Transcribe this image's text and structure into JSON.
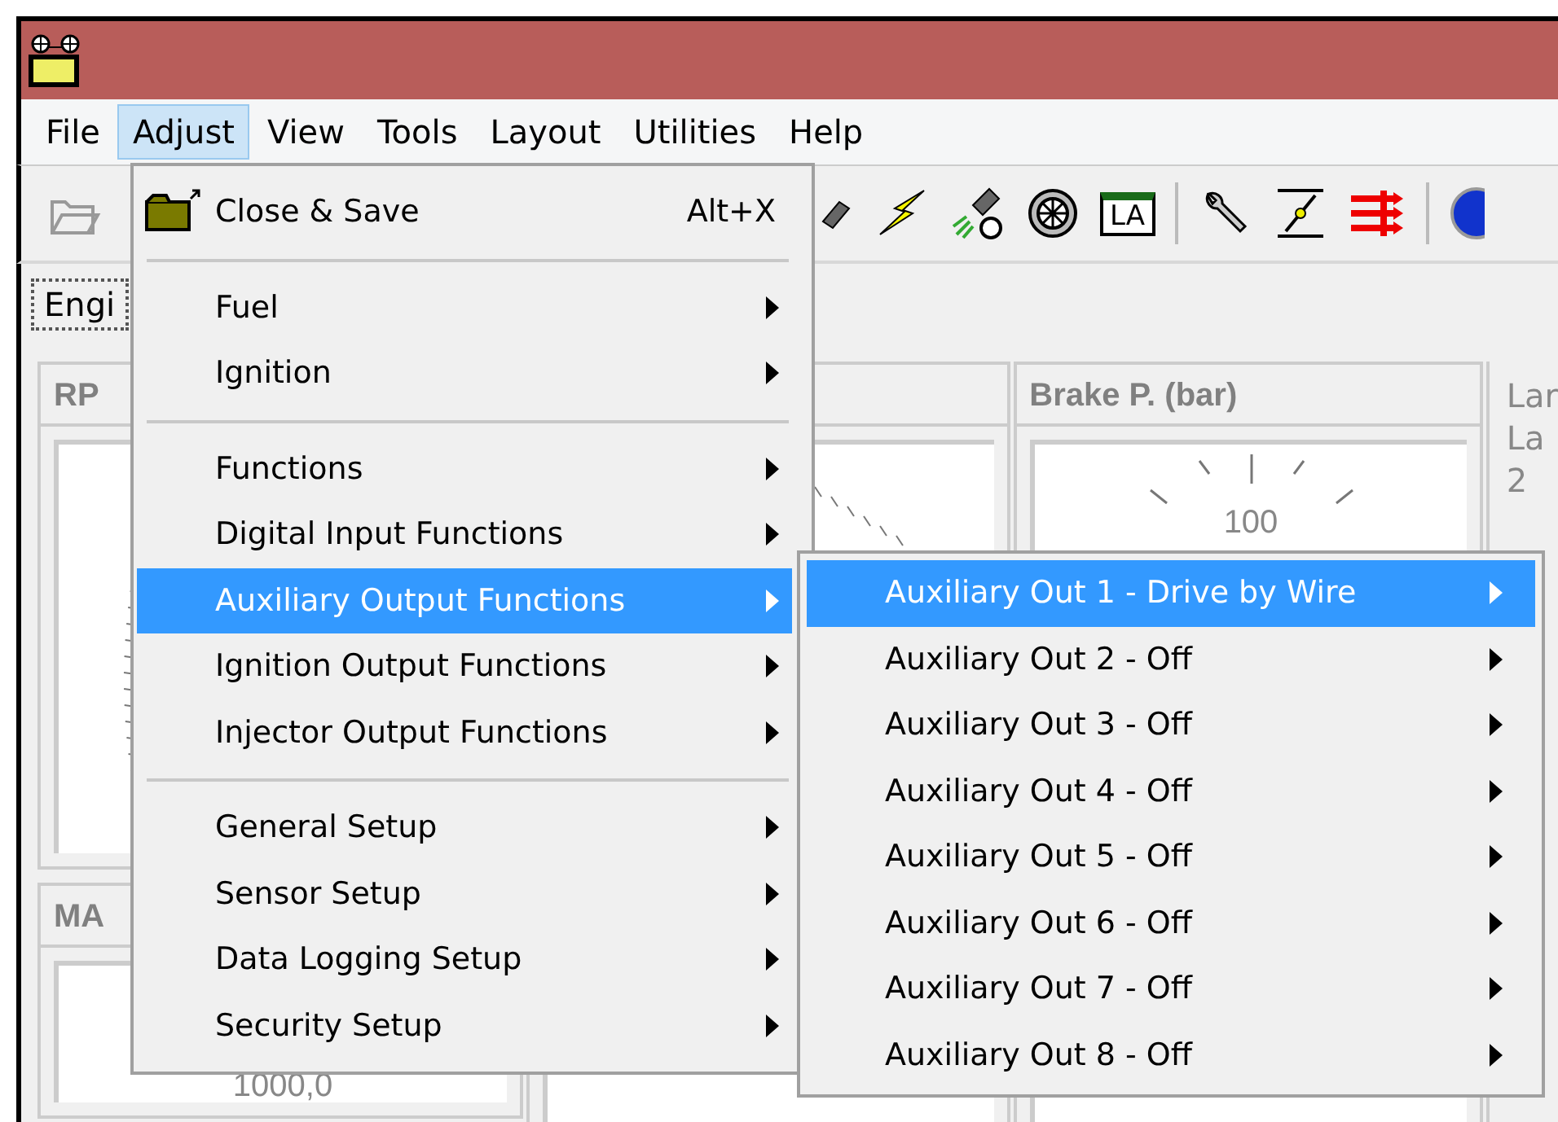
{
  "menubar": [
    {
      "label": "File",
      "selected": false
    },
    {
      "label": "Adjust",
      "selected": true
    },
    {
      "label": "View",
      "selected": false
    },
    {
      "label": "Tools",
      "selected": false
    },
    {
      "label": "Layout",
      "selected": false
    },
    {
      "label": "Utilities",
      "selected": false
    },
    {
      "label": "Help",
      "selected": false
    }
  ],
  "tab": {
    "label": "Engi"
  },
  "toolbar": {
    "la_label": "LA"
  },
  "gauges": [
    {
      "title": "RP"
    },
    {
      "title": "Brake P. (bar)",
      "reading": "100"
    }
  ],
  "gauges_lower": [
    {
      "title": "MA",
      "reading": "1000,0"
    }
  ],
  "side_panel": {
    "lines": [
      "Lar",
      "La",
      "2"
    ]
  },
  "adjust_menu": [
    {
      "kind": "command",
      "label": "Close & Save",
      "shortcut": "Alt+X",
      "selected": false
    },
    {
      "kind": "separator"
    },
    {
      "kind": "submenu",
      "label": "Fuel",
      "selected": false
    },
    {
      "kind": "submenu",
      "label": "Ignition",
      "selected": false
    },
    {
      "kind": "separator"
    },
    {
      "kind": "submenu",
      "label": "Functions",
      "selected": false
    },
    {
      "kind": "submenu",
      "label": "Digital Input Functions",
      "selected": false
    },
    {
      "kind": "submenu",
      "label": "Auxiliary Output Functions",
      "selected": true
    },
    {
      "kind": "submenu",
      "label": "Ignition Output Functions",
      "selected": false
    },
    {
      "kind": "submenu",
      "label": "Injector Output Functions",
      "selected": false
    },
    {
      "kind": "separator"
    },
    {
      "kind": "submenu",
      "label": "General Setup",
      "selected": false
    },
    {
      "kind": "submenu",
      "label": "Sensor Setup",
      "selected": false
    },
    {
      "kind": "submenu",
      "label": "Data Logging Setup",
      "selected": false
    },
    {
      "kind": "submenu",
      "label": "Security Setup",
      "selected": false
    }
  ],
  "aux_submenu": [
    {
      "label": "Auxiliary Out 1 - Drive by Wire",
      "selected": true
    },
    {
      "label": "Auxiliary Out 2 - Off",
      "selected": false
    },
    {
      "label": "Auxiliary Out 3 - Off",
      "selected": false
    },
    {
      "label": "Auxiliary Out 4 - Off",
      "selected": false
    },
    {
      "label": "Auxiliary Out 5 - Off",
      "selected": false
    },
    {
      "label": "Auxiliary Out 6 - Off",
      "selected": false
    },
    {
      "label": "Auxiliary Out 7 - Off",
      "selected": false
    },
    {
      "label": "Auxiliary Out 8 - Off",
      "selected": false
    }
  ]
}
